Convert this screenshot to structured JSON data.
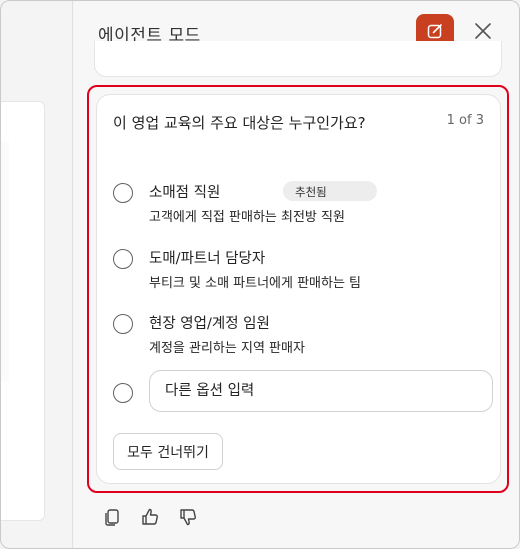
{
  "header": {
    "title": "에이전트 모드"
  },
  "question_card": {
    "question": "이 영업 교육의 주요 대상은 누구인가요?",
    "counter": "1 of 3",
    "options": [
      {
        "title": "소매점 직원",
        "badge": "추천됨",
        "description": "고객에게 직접 판매하는 최전방 직원"
      },
      {
        "title": "도매/파트너 담당자",
        "description": "부티크 및 소매 파트너에게 판매하는 팀"
      },
      {
        "title": "현장 영업/계정 임원",
        "description": "계정을 관리하는 지역 판매자"
      }
    ],
    "other_placeholder": "다른 옵션 입력",
    "skip_label": "모두 건너뛰기"
  },
  "colors": {
    "accent": "#c8401f",
    "highlight": "#e0001b"
  },
  "icons": {
    "new_chat": "compose-icon",
    "close": "close-icon",
    "copy": "copy-icon",
    "like": "thumbs-up-icon",
    "dislike": "thumbs-down-icon"
  }
}
